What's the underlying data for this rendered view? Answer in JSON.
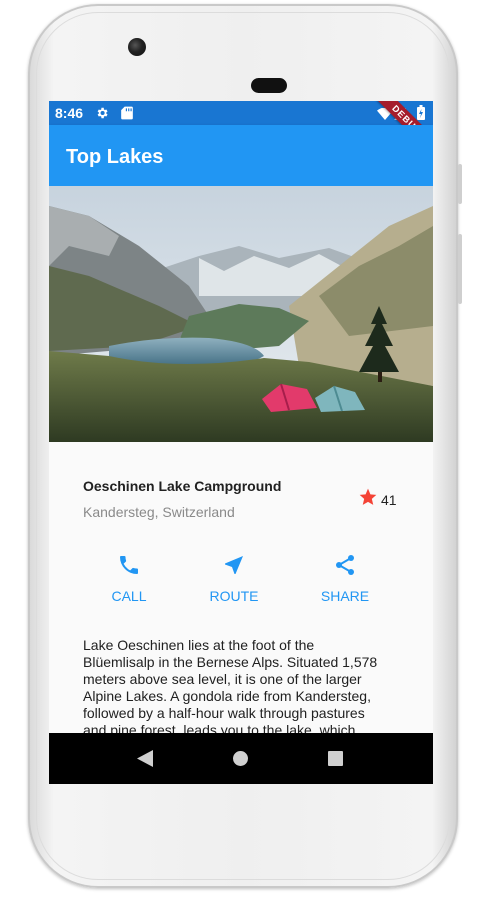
{
  "status_bar": {
    "time": "8:46",
    "debug_banner": "DEBUG",
    "icons": [
      "settings-icon",
      "sd-card-icon",
      "wifi-icon",
      "battery-icon"
    ]
  },
  "app_bar": {
    "title": "Top Lakes"
  },
  "hero_image": {
    "subject": "lake-valley-with-tents-photo"
  },
  "place": {
    "name": "Oeschinen Lake Campground",
    "location": "Kandersteg, Switzerland",
    "favorite_count": "41",
    "favorite_icon": "star-icon"
  },
  "actions": [
    {
      "label": "CALL",
      "icon": "phone-icon"
    },
    {
      "label": "ROUTE",
      "icon": "navigation-icon"
    },
    {
      "label": "SHARE",
      "icon": "share-icon"
    }
  ],
  "description_lines": [
    "Lake Oeschinen lies at the foot of the",
    "Blüemlisalp in the Bernese Alps. Situated 1,578",
    "meters above sea level, it is one of the larger",
    "Alpine Lakes. A gondola ride from Kandersteg,",
    "followed by a half-hour walk through pastures",
    "and pine forest, leads you to the lake, which"
  ],
  "nav_bar": {
    "buttons": [
      "back-icon",
      "home-icon",
      "recents-icon"
    ]
  },
  "colors": {
    "primary": "#2196f3",
    "status_bar": "#1976d2",
    "star": "#f44336",
    "debug_ribbon": "#a51d2d"
  }
}
